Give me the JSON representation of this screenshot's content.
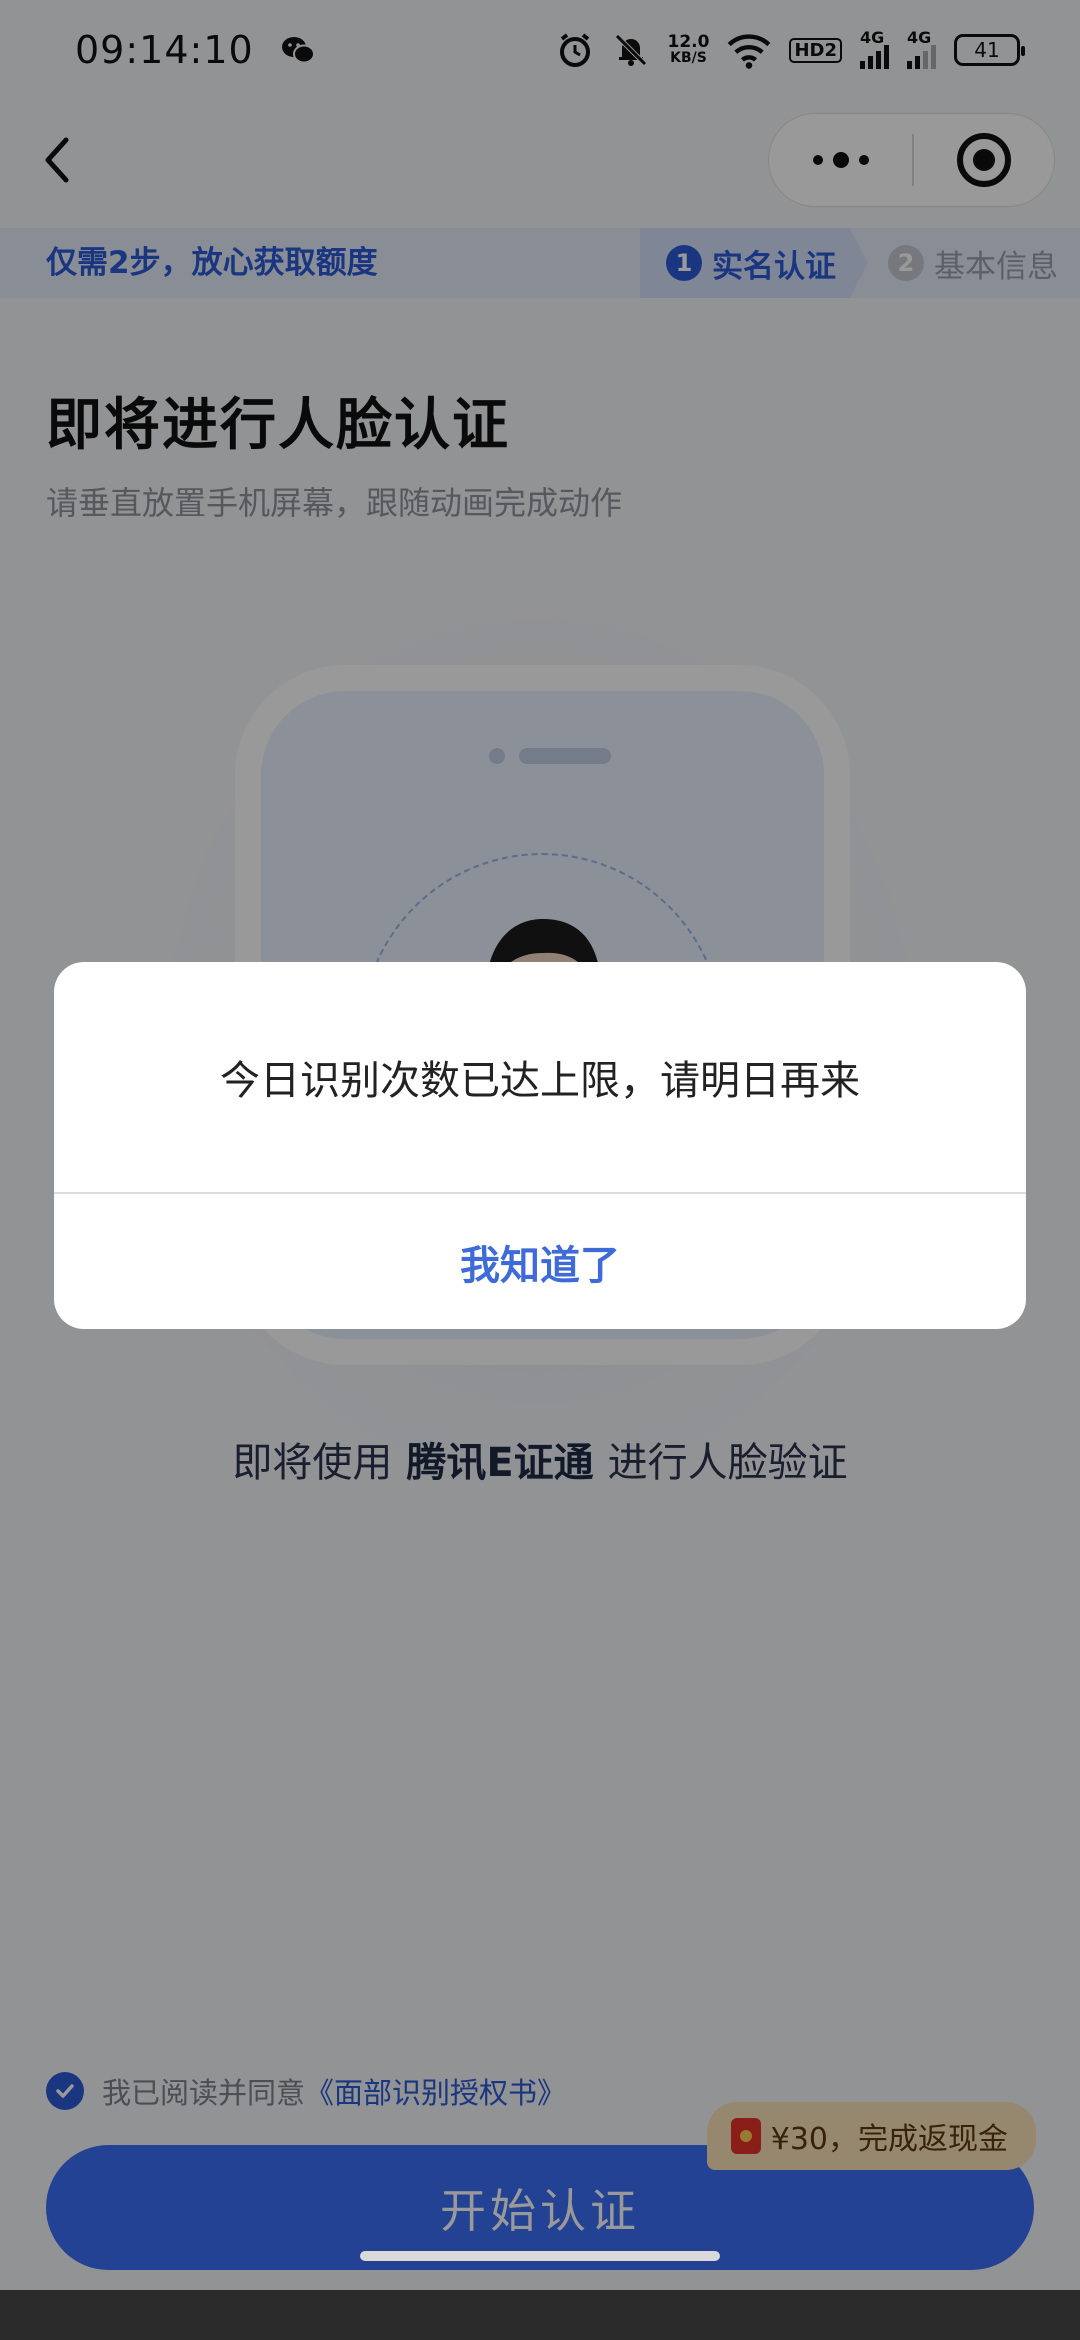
{
  "status_bar": {
    "time": "09:14:10",
    "net_speed_value": "12.0",
    "net_speed_unit": "KB/S",
    "hd_label": "HD2",
    "signal1_label": "4G",
    "signal2_label": "4G",
    "battery": "41",
    "icons": [
      "wechat-icon",
      "alarm-icon",
      "bell-muted-icon",
      "wifi-icon",
      "hd-icon",
      "signal-icon",
      "signal-icon",
      "battery-icon"
    ]
  },
  "nav": {
    "back_icon": "chevron-left-icon",
    "capsule_more_icon": "more-dots-icon",
    "capsule_close_icon": "target-circle-icon"
  },
  "steps": {
    "tip": "仅需2步，放心获取额度",
    "items": [
      {
        "num": "1",
        "label": "实名认证",
        "state": "active"
      },
      {
        "num": "2",
        "label": "基本信息",
        "state": "inactive"
      }
    ]
  },
  "content": {
    "title": "即将进行人脸认证",
    "subtitle": "请垂直放置手机屏幕，跟随动画完成动作",
    "eid_prefix": "即将使用",
    "eid_name": "腾讯E证通",
    "eid_suffix": "进行人脸验证"
  },
  "agreement": {
    "text": "我已阅读并同意",
    "link": "《面部识别授权书》",
    "checked": true
  },
  "cashback": {
    "text": "¥30，完成返现金"
  },
  "start_button": {
    "label": "开始认证"
  },
  "dialog": {
    "message": "今日识别次数已达上限，请明日再来",
    "confirm_label": "我知道了"
  },
  "colors": {
    "primary": "#3d6ef6",
    "link": "#2e5bd6",
    "dialog_button": "#3f6bd8",
    "cashback_bg": "#fbe3b9"
  }
}
